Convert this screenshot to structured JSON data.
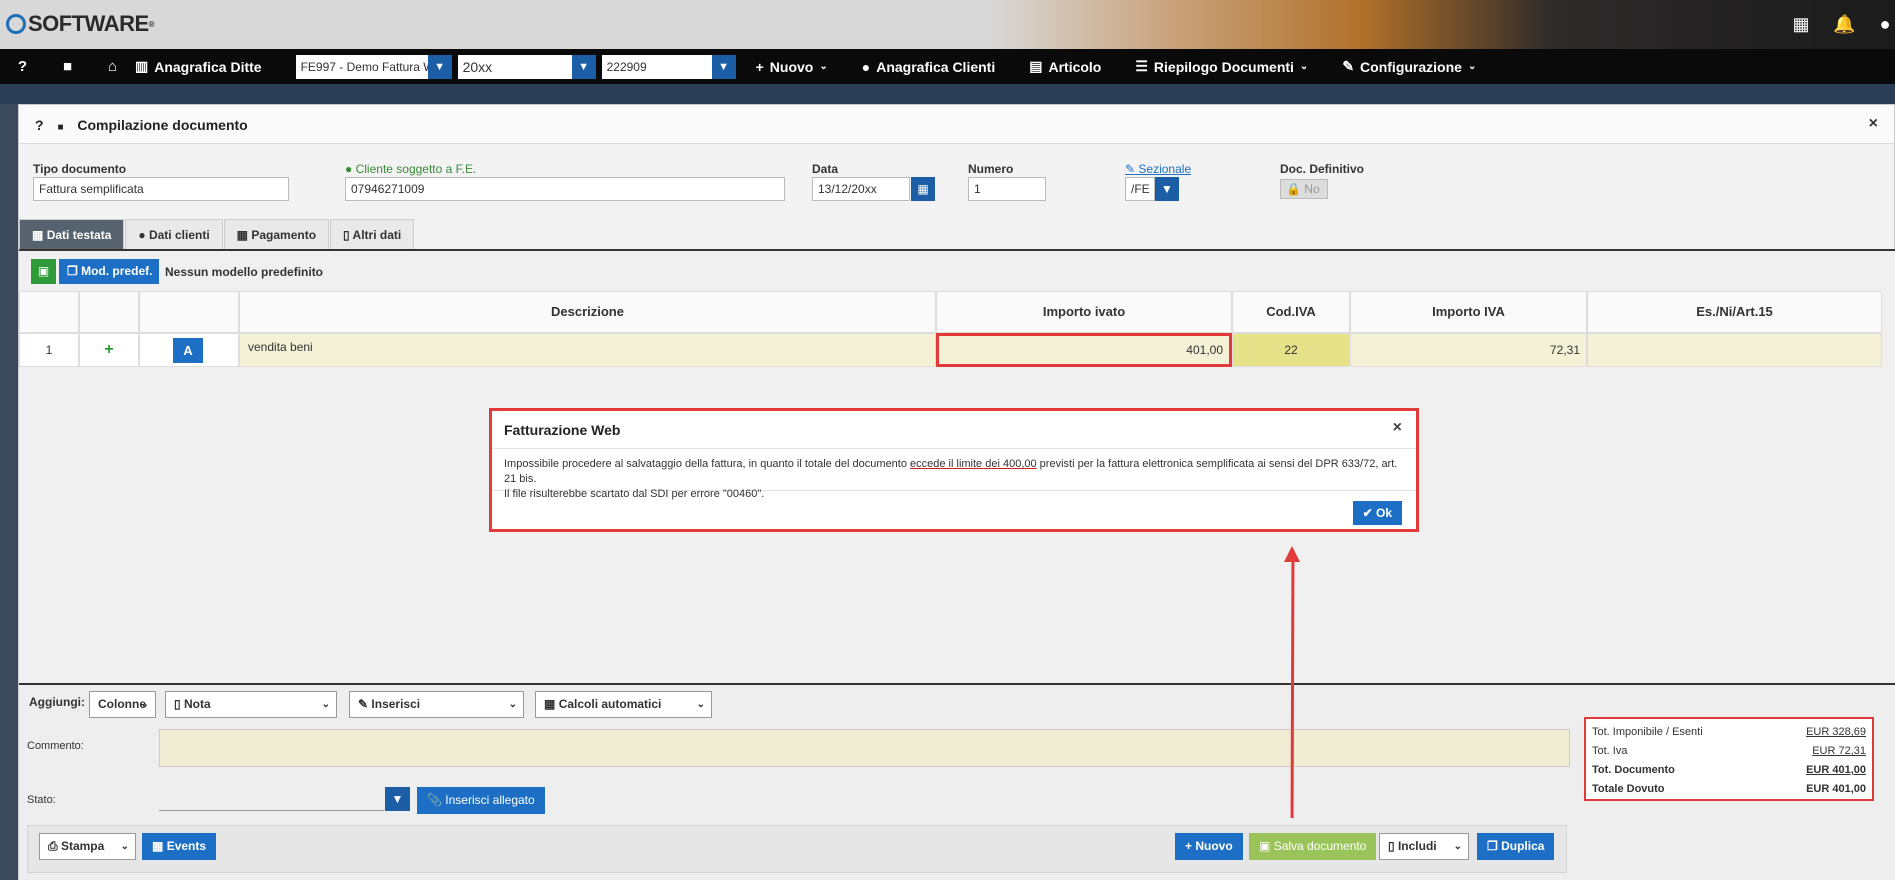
{
  "header": {
    "logo": "SOFTWARE",
    "logo_sup": "®",
    "icons": [
      "grid-icon",
      "bell-icon",
      "user-icon"
    ]
  },
  "nav": {
    "help": "?",
    "anagrafica_ditte": "Anagrafica Ditte",
    "ditta_value": "FE997 - Demo Fattura Wel",
    "anno_value": "20xx",
    "codice_value": "222909",
    "nuovo": "Nuovo",
    "anagrafica_clienti": "Anagrafica Clienti",
    "articolo": "Articolo",
    "riepilogo": "Riepilogo Documenti",
    "configurazione": "Configurazione"
  },
  "panel": {
    "title": "Compilazione documento",
    "close": "×",
    "fields": {
      "tipo_label": "Tipo documento",
      "tipo_value": "Fattura semplificata",
      "cliente_label": "Cliente soggetto a F.E.",
      "cliente_value": "07946271009",
      "data_label": "Data",
      "data_value": "13/12/20xx",
      "numero_label": "Numero",
      "numero_value": "1",
      "sezionale_label": "Sezionale",
      "sezionale_value": "/FE",
      "definitivo_label": "Doc. Definitivo",
      "definitivo_value": "No"
    },
    "tabs": [
      "Dati testata",
      "Dati clienti",
      "Pagamento",
      "Altri dati"
    ]
  },
  "toolbar": {
    "mod_predef": "Mod. predef.",
    "nessun_modello": "Nessun modello predefinito"
  },
  "grid": {
    "columns": [
      "Descrizione",
      "Importo ivato",
      "Cod.IVA",
      "Importo IVA",
      "Es./Ni/Art.15"
    ],
    "row": {
      "num": "1",
      "add": "+",
      "btn": "A",
      "descrizione": "vendita beni",
      "importo_ivato": "401,00",
      "cod_iva": "22",
      "importo_iva": "72,31"
    }
  },
  "footer": {
    "aggiungi": "Aggiungi:",
    "colonne": "Colonne",
    "nota": "Nota",
    "inserisci": "Inserisci",
    "calcoli": "Calcoli automatici",
    "commento": "Commento:",
    "stato": "Stato:",
    "inserisci_allegato": "Inserisci allegato",
    "stampa": "Stampa",
    "events": "Events",
    "nuovo": "Nuovo",
    "salva": "Salva documento",
    "includi": "Includi",
    "duplica": "Duplica"
  },
  "totals": {
    "imponibile_label": "Tot. Imponibile / Esenti",
    "imponibile_value": "EUR 328,69",
    "iva_label": "Tot. Iva",
    "iva_value": "EUR 72,31",
    "documento_label": "Tot. Documento",
    "documento_value": "EUR 401,00",
    "dovuto_label": "Totale Dovuto",
    "dovuto_value": "EUR 401,00"
  },
  "modal": {
    "title": "Fatturazione Web",
    "close": "×",
    "text_a": "Impossibile procedere al salvataggio della fattura, in quanto il totale del documento ",
    "text_ul": "eccede il limite dei 400,00",
    "text_b": " previsti per la fattura elettronica semplificata ai sensi del DPR 633/72, art. 21 bis.",
    "text_line2": "Il file risulterebbe scartato dal SDI per errore \"00460\".",
    "ok": "Ok"
  }
}
